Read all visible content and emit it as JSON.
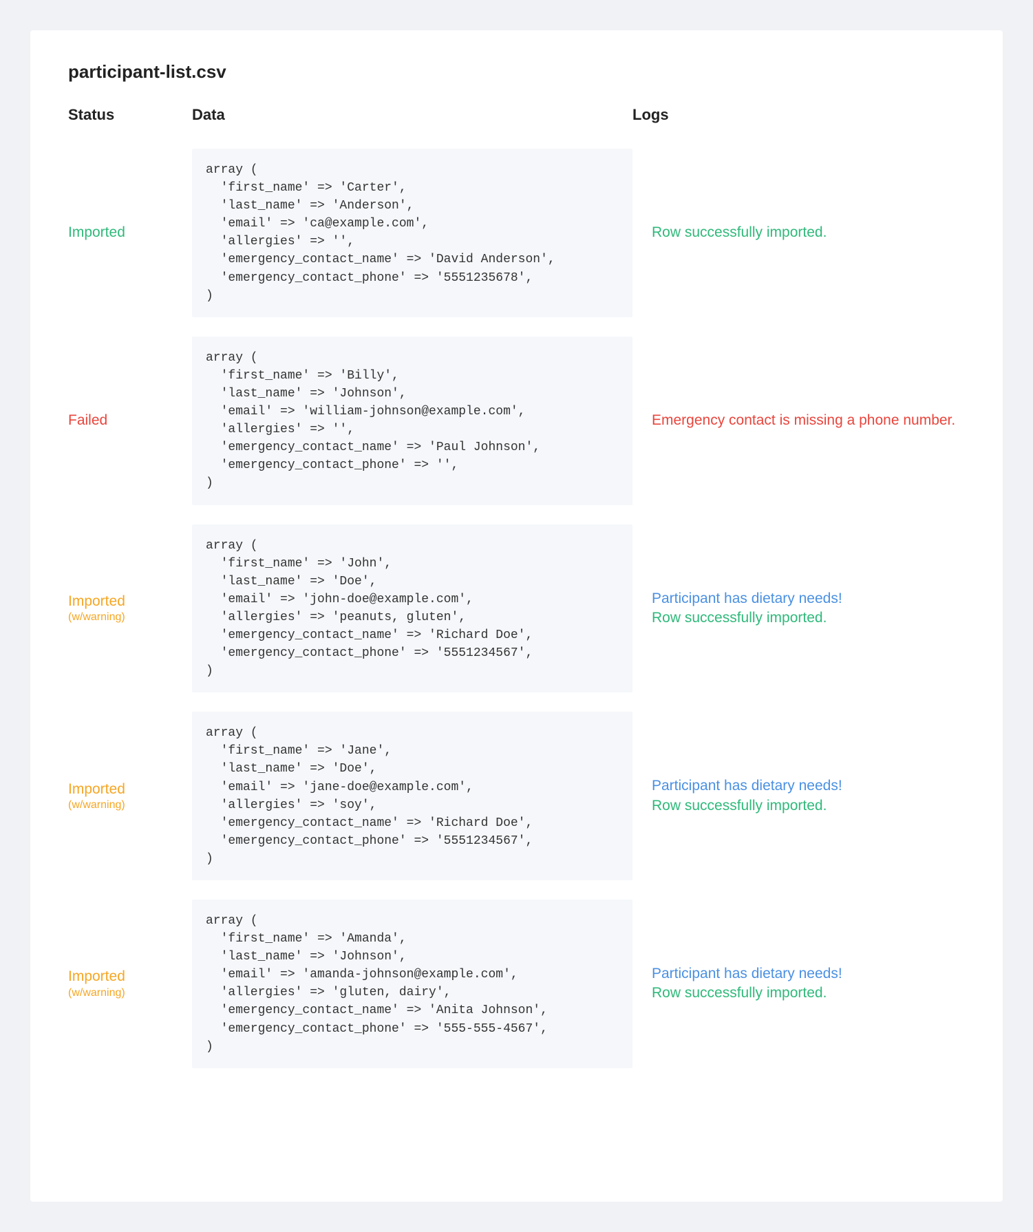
{
  "filename": "participant-list.csv",
  "columns": {
    "status": "Status",
    "data": "Data",
    "logs": "Logs"
  },
  "status_labels": {
    "imported": "Imported",
    "failed": "Failed",
    "warning_main": "Imported",
    "warning_sub": "(w/warning)"
  },
  "log_messages": {
    "row_success": "Row successfully imported.",
    "dietary": "Participant has dietary needs!",
    "missing_phone": "Emergency contact is missing a phone number."
  },
  "rows": [
    {
      "status": "imported",
      "data": "array (\n  'first_name' => 'Carter',\n  'last_name' => 'Anderson',\n  'email' => 'ca@example.com',\n  'allergies' => '',\n  'emergency_contact_name' => 'David Anderson',\n  'emergency_contact_phone' => '5551235678',\n)",
      "logs": [
        {
          "type": "success",
          "key": "row_success"
        }
      ]
    },
    {
      "status": "failed",
      "data": "array (\n  'first_name' => 'Billy',\n  'last_name' => 'Johnson',\n  'email' => 'william-johnson@example.com',\n  'allergies' => '',\n  'emergency_contact_name' => 'Paul Johnson',\n  'emergency_contact_phone' => '',\n)",
      "logs": [
        {
          "type": "error",
          "key": "missing_phone"
        }
      ]
    },
    {
      "status": "warning",
      "data": "array (\n  'first_name' => 'John',\n  'last_name' => 'Doe',\n  'email' => 'john-doe@example.com',\n  'allergies' => 'peanuts, gluten',\n  'emergency_contact_name' => 'Richard Doe',\n  'emergency_contact_phone' => '5551234567',\n)",
      "logs": [
        {
          "type": "info",
          "key": "dietary"
        },
        {
          "type": "success",
          "key": "row_success"
        }
      ]
    },
    {
      "status": "warning",
      "data": "array (\n  'first_name' => 'Jane',\n  'last_name' => 'Doe',\n  'email' => 'jane-doe@example.com',\n  'allergies' => 'soy',\n  'emergency_contact_name' => 'Richard Doe',\n  'emergency_contact_phone' => '5551234567',\n)",
      "logs": [
        {
          "type": "info",
          "key": "dietary"
        },
        {
          "type": "success",
          "key": "row_success"
        }
      ]
    },
    {
      "status": "warning",
      "data": "array (\n  'first_name' => 'Amanda',\n  'last_name' => 'Johnson',\n  'email' => 'amanda-johnson@example.com',\n  'allergies' => 'gluten, dairy',\n  'emergency_contact_name' => 'Anita Johnson',\n  'emergency_contact_phone' => '555-555-4567',\n)",
      "logs": [
        {
          "type": "info",
          "key": "dietary"
        },
        {
          "type": "success",
          "key": "row_success"
        }
      ]
    }
  ]
}
